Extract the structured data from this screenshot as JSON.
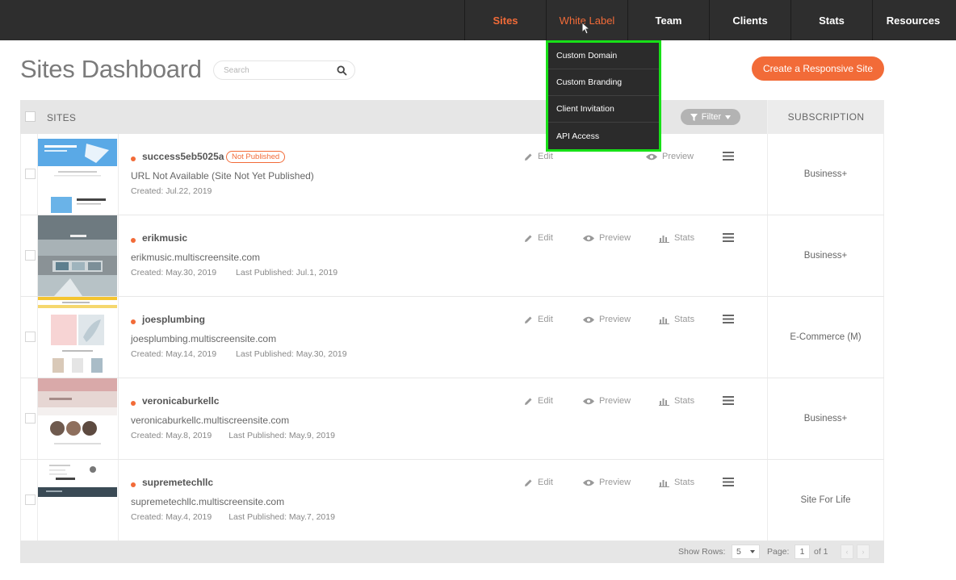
{
  "nav": {
    "items": [
      {
        "label": "Sites"
      },
      {
        "label": "White Label"
      },
      {
        "label": "Team"
      },
      {
        "label": "Clients"
      },
      {
        "label": "Stats"
      },
      {
        "label": "Resources"
      }
    ],
    "active_index": 0,
    "hover_index": 1,
    "accent": "#f26b38"
  },
  "header": {
    "title": "Sites Dashboard",
    "search_placeholder": "Search",
    "create_button": "Create a Responsive Site"
  },
  "dropdown": {
    "items": [
      "Custom Domain",
      "Custom Branding",
      "Client Invitation",
      "API Access"
    ],
    "highlight_color": "#18e018"
  },
  "table": {
    "col_sites": "SITES",
    "col_subscription": "SUBSCRIPTION",
    "filter_label": "Filter",
    "action_labels": {
      "edit": "Edit",
      "preview": "Preview",
      "stats": "Stats"
    },
    "rows": [
      {
        "name": "success5eb5025a",
        "badge": "Not Published",
        "url": "URL Not Available (Site Not Yet Published)",
        "created": "Created: Jul.22, 2019",
        "published": "",
        "subscription": "Business+"
      },
      {
        "name": "erikmusic",
        "badge": "",
        "url": "erikmusic.multiscreensite.com",
        "created": "Created: May.30, 2019",
        "published": "Last Published: Jul.1, 2019",
        "subscription": "Business+"
      },
      {
        "name": "joesplumbing",
        "badge": "",
        "url": "joesplumbing.multiscreensite.com",
        "created": "Created: May.14, 2019",
        "published": "Last Published: May.30, 2019",
        "subscription": "E-Commerce (M)"
      },
      {
        "name": "veronicaburkellc",
        "badge": "",
        "url": "veronicaburkellc.multiscreensite.com",
        "created": "Created: May.8, 2019",
        "published": "Last Published: May.9, 2019",
        "subscription": "Business+"
      },
      {
        "name": "supremetechllc",
        "badge": "",
        "url": "supremetechllc.multiscreensite.com",
        "created": "Created: May.4, 2019",
        "published": "Last Published: May.7, 2019",
        "subscription": "Site For Life"
      }
    ]
  },
  "footer": {
    "show_rows_label": "Show Rows:",
    "rows_value": "5",
    "page_label": "Page:",
    "page_value": "1",
    "page_of": "of 1"
  }
}
